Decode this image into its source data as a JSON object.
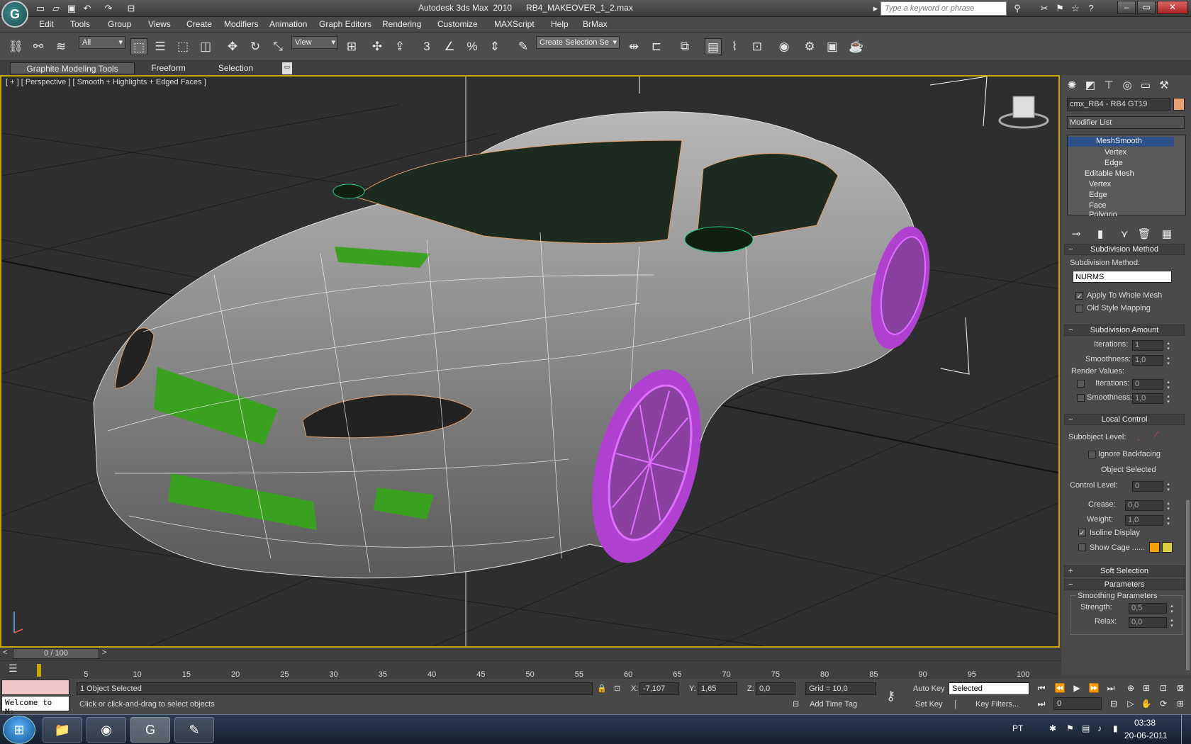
{
  "titlebar": {
    "title": "Autodesk 3ds Max  2010      RB4_MAKEOVER_1_2.max",
    "search_placeholder": "Type a keyword or phrase",
    "app_logo": "3ds-max-logo-icon"
  },
  "menu": [
    "Edit",
    "Tools",
    "Group",
    "Views",
    "Create",
    "Modifiers",
    "Animation",
    "Graph Editors",
    "Rendering",
    "Customize",
    "MAXScript",
    "Help",
    "BrMax"
  ],
  "toolbar": {
    "selection_filter": "All",
    "ref_coord": "View",
    "named_selection_placeholder": "Create Selection Se"
  },
  "ribbon": {
    "tabs": [
      "Graphite Modeling Tools",
      "Freeform",
      "Selection"
    ]
  },
  "viewport": {
    "label": "[ + ] [ Perspective ] [ Smooth + Highlights + Edged Faces ]"
  },
  "command_panel": {
    "object_name": "cmx_RB4 - RB4 GT19",
    "object_color": "#e8a070",
    "modifier_list": "Modifier List",
    "stack": [
      {
        "label": "MeshSmooth",
        "level": 0,
        "selected": true
      },
      {
        "label": "Vertex",
        "level": 2
      },
      {
        "label": "Edge",
        "level": 2
      },
      {
        "label": "Editable Mesh",
        "level": 0
      },
      {
        "label": "Vertex",
        "level": 1
      },
      {
        "label": "Edge",
        "level": 1
      },
      {
        "label": "Face",
        "level": 1
      },
      {
        "label": "Polygon",
        "level": 1
      }
    ],
    "subdivision_method": {
      "header": "Subdivision Method",
      "label": "Subdivision Method:",
      "value": "NURMS",
      "apply_whole_mesh": "Apply To Whole Mesh",
      "old_style_mapping": "Old Style Mapping"
    },
    "subdivision_amount": {
      "header": "Subdivision Amount",
      "iterations_label": "Iterations:",
      "iterations": "1",
      "smoothness_label": "Smoothness:",
      "smoothness": "1,0",
      "render_values": "Render Values:",
      "r_iterations": "0",
      "r_smoothness": "1,0"
    },
    "local_control": {
      "header": "Local Control",
      "subobject_level": "Subobject Level:",
      "ignore_backfacing": "Ignore Backfacing",
      "object_selected": "Object Selected",
      "control_level_label": "Control Level:",
      "control_level": "0",
      "crease_label": "Crease:",
      "crease": "0,0",
      "weight_label": "Weight:",
      "weight": "1,0",
      "isoline_display": "Isoline Display",
      "show_cage": "Show Cage ......",
      "cage_color_1": "#f5a000",
      "cage_color_2": "#d8d040"
    },
    "soft_selection": "Soft Selection",
    "parameters": {
      "header": "Parameters",
      "group": "Smoothing Parameters",
      "strength_label": "Strength:",
      "strength": "0,5",
      "relax_label": "Relax:",
      "relax": "0,0"
    }
  },
  "timeline": {
    "frame": "0 / 100",
    "ticks": [
      "5",
      "10",
      "15",
      "20",
      "25",
      "30",
      "35",
      "40",
      "45",
      "50",
      "55",
      "60",
      "65",
      "70",
      "75",
      "80",
      "85",
      "90",
      "95",
      "100"
    ]
  },
  "status": {
    "listener": "Welcome to M:",
    "selected": "1 Object Selected",
    "prompt": "Click or click-and-drag to select objects",
    "x_label": "X:",
    "x": "-7,107",
    "y_label": "Y:",
    "y": "1,65",
    "z_label": "Z:",
    "z": "0,0",
    "grid": "Grid = 10,0",
    "auto_key": "Auto Key",
    "set_key": "Set Key",
    "key_mode": "Selected",
    "key_filters": "Key Filters...",
    "add_time_tag": "Add Time Tag",
    "frame_field": "0"
  },
  "taskbar": {
    "lang": "PT",
    "time": "03:38",
    "date": "20-06-2011"
  }
}
